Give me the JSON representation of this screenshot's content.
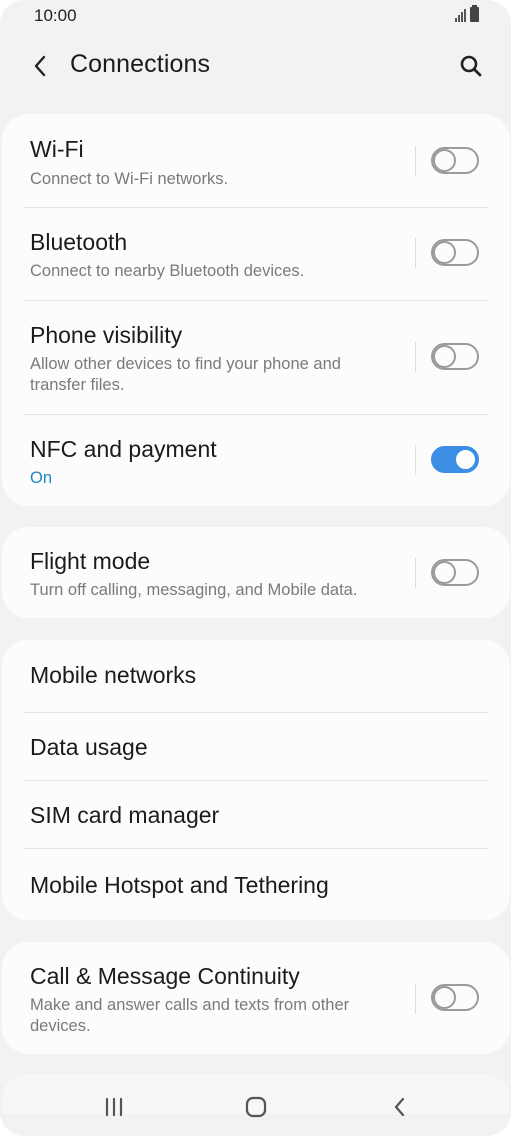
{
  "status_bar": {
    "time": "10:00"
  },
  "header": {
    "title": "Connections"
  },
  "sections": {
    "wifi": {
      "title": "Wi-Fi",
      "subtitle": "Connect to Wi-Fi networks.",
      "enabled": false
    },
    "bluetooth": {
      "title": "Bluetooth",
      "subtitle": "Connect to nearby Bluetooth devices.",
      "enabled": false
    },
    "phone_visibility": {
      "title": "Phone visibility",
      "subtitle_line1": "Allow other devices to find your phone and",
      "subtitle_line2": "transfer files.",
      "enabled": false
    },
    "nfc": {
      "title": "NFC and payment",
      "subtitle": "On",
      "enabled": true
    },
    "flight_mode": {
      "title": "Flight mode",
      "subtitle": "Turn off calling, messaging, and Mobile data.",
      "enabled": false
    },
    "mobile_networks": {
      "title": "Mobile networks"
    },
    "data_usage": {
      "title": "Data usage"
    },
    "sim_manager": {
      "title": "SIM card manager"
    },
    "hotspot": {
      "title": "Mobile Hotspot and Tethering"
    },
    "continuity": {
      "title": "Call & Message Continuity",
      "subtitle_line1": "Make and answer calls and texts from other",
      "subtitle_line2": "devices.",
      "enabled": false
    }
  },
  "colors": {
    "accent": "#3b8ee3",
    "on_text": "#1d86c8",
    "background": "#f2f2f2",
    "card": "#fcfcfc"
  },
  "icons": {
    "back": "chevron-left-icon",
    "search": "search-icon",
    "recents": "recent-apps-icon",
    "home": "home-icon",
    "nav_back": "nav-back-icon"
  }
}
